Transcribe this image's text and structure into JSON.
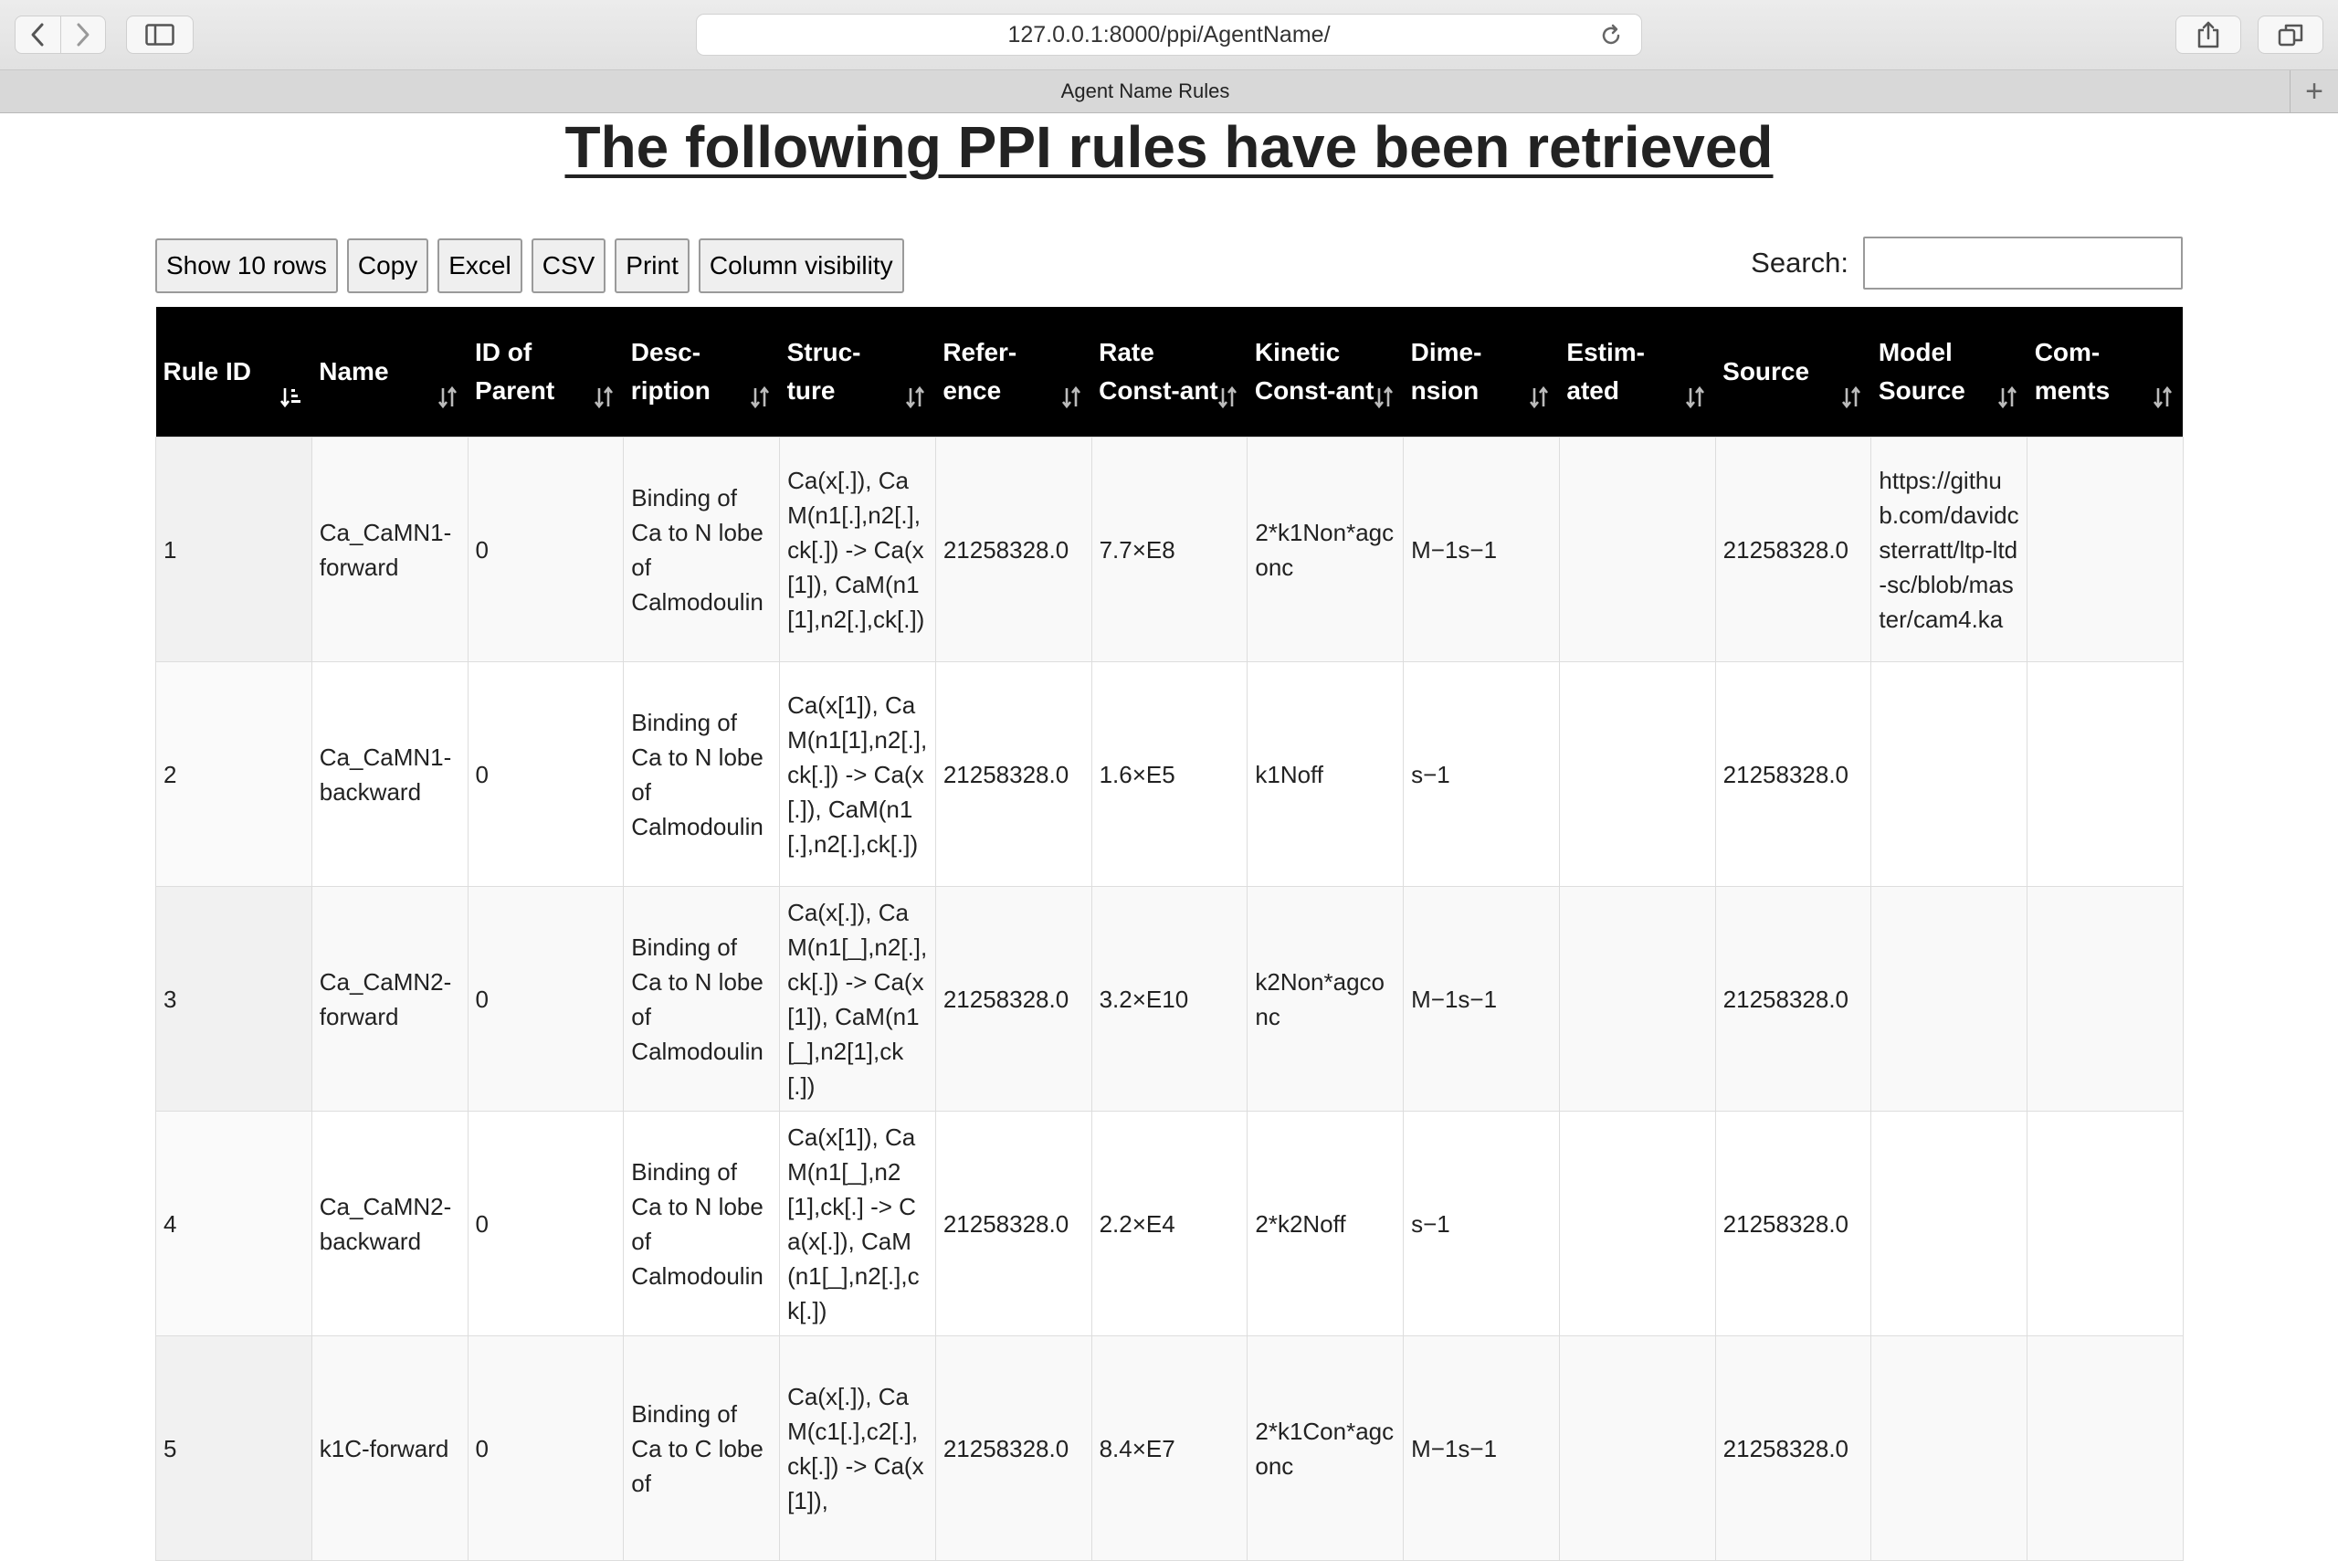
{
  "browser": {
    "url": "127.0.0.1:8000/ppi/AgentName/",
    "tab_title": "Agent Name Rules"
  },
  "page": {
    "title": "The following PPI rules have been retrieved"
  },
  "buttons": {
    "show_rows": "Show 10 rows",
    "copy": "Copy",
    "excel": "Excel",
    "csv": "CSV",
    "print": "Print",
    "column_visibility": "Column visibility"
  },
  "search": {
    "label": "Search:",
    "value": ""
  },
  "table": {
    "columns": [
      "Rule ID",
      "Name",
      "ID of Parent",
      "Desc-ription",
      "Struc-ture",
      "Refer-ence",
      "Rate Const-ant",
      "Kinetic Const-ant",
      "Dime-nsion",
      "Estim-ated",
      "Source",
      "Model Source",
      "Com-ments"
    ],
    "rows": [
      [
        "1",
        "Ca_CaMN1-forward",
        "0",
        "Binding of Ca to N lobe of Calmodoulin",
        "Ca(x[.]), CaM(n1[.],n2[.],ck[.]) -> Ca(x[1]), CaM(n1[1],n2[.],ck[.])",
        "21258328.0",
        "7.7×E8",
        "2*k1Non*agconc",
        "M−1s−1",
        "",
        "21258328.0",
        "https://github.com/davidcsterratt/ltp-ltd-sc/blob/master/cam4.ka",
        ""
      ],
      [
        "2",
        "Ca_CaMN1-backward",
        "0",
        "Binding of Ca to N lobe of Calmodoulin",
        "Ca(x[1]), CaM(n1[1],n2[.],ck[.]) -> Ca(x[.]), CaM(n1[.],n2[.],ck[.])",
        "21258328.0",
        "1.6×E5",
        "k1Noff",
        "s−1",
        "",
        "21258328.0",
        "",
        ""
      ],
      [
        "3",
        "Ca_CaMN2-forward",
        "0",
        "Binding of Ca to N lobe of Calmodoulin",
        "Ca(x[.]), CaM(n1[_],n2[.],ck[.]) -> Ca(x[1]), CaM(n1[_],n2[1],ck[.])",
        "21258328.0",
        "3.2×E10",
        "k2Non*agconc",
        "M−1s−1",
        "",
        "21258328.0",
        "",
        ""
      ],
      [
        "4",
        "Ca_CaMN2-backward",
        "0",
        "Binding of Ca to N lobe of Calmodoulin",
        "Ca(x[1]), CaM(n1[_],n2[1],ck[.] -> Ca(x[.]), CaM(n1[_],n2[.],ck[.])",
        "21258328.0",
        "2.2×E4",
        "2*k2Noff",
        "s−1",
        "",
        "21258328.0",
        "",
        ""
      ],
      [
        "5",
        "k1C-forward",
        "0",
        "Binding of Ca to C lobe of",
        "Ca(x[.]), CaM(c1[.],c2[.],ck[.]) -> Ca(x[1]),",
        "21258328.0",
        "8.4×E7",
        "2*k1Con*agconc",
        "M−1s−1",
        "",
        "21258328.0",
        "",
        ""
      ]
    ]
  }
}
